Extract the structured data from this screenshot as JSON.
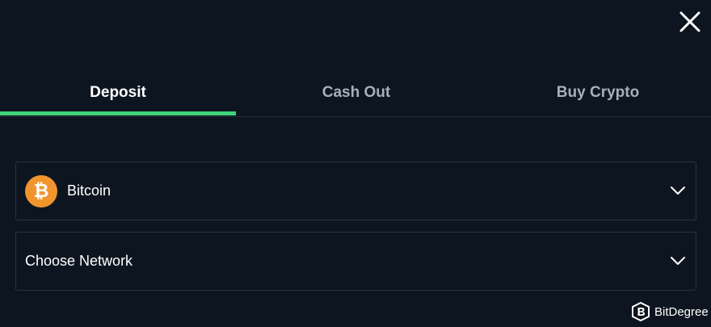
{
  "tabs": [
    {
      "label": "Deposit",
      "active": true
    },
    {
      "label": "Cash Out",
      "active": false
    },
    {
      "label": "Buy Crypto",
      "active": false
    }
  ],
  "coin_select": {
    "icon": "bitcoin-icon",
    "icon_glyph": "₿",
    "value": "Bitcoin"
  },
  "network_select": {
    "value": "Choose Network"
  },
  "watermark": {
    "text": "BitDegree",
    "icon": "bitdegree-logo-icon"
  },
  "colors": {
    "background": "#0d1620",
    "accent": "#3fd37a",
    "bitcoin": "#f0952e",
    "inactive_tab": "#a7afb9",
    "border": "#2b3540"
  }
}
